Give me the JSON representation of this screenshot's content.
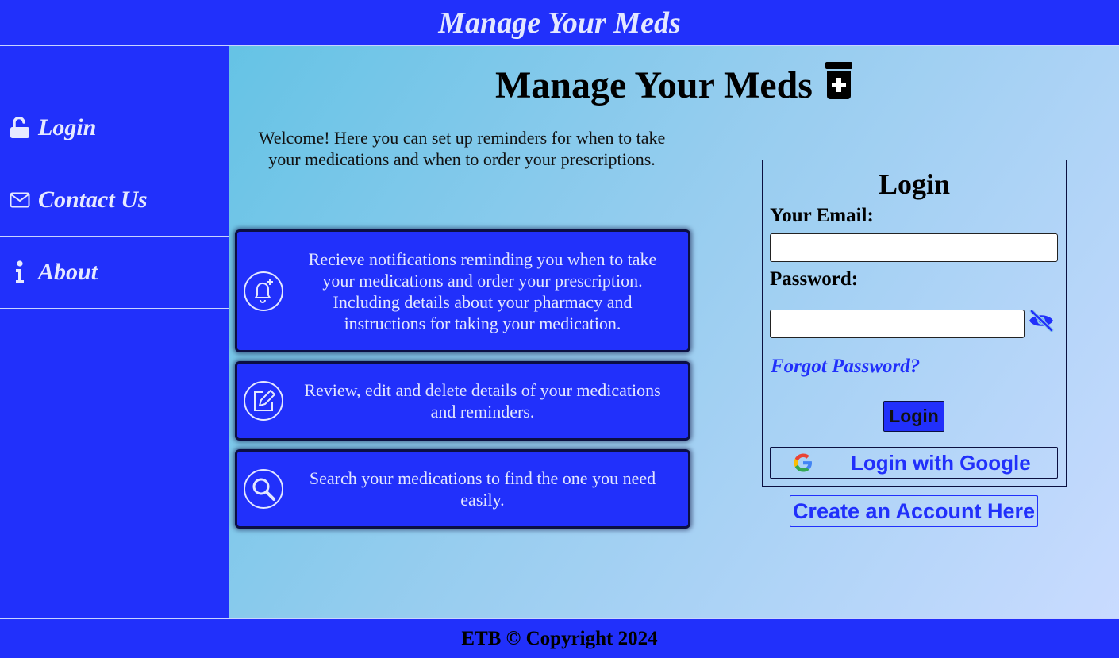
{
  "header": {
    "title": "Manage Your Meds"
  },
  "sidebar": {
    "items": [
      {
        "label": "Login",
        "icon": "unlock-icon"
      },
      {
        "label": "Contact Us",
        "icon": "envelope-icon"
      },
      {
        "label": "About",
        "icon": "info-icon"
      }
    ]
  },
  "main": {
    "title": "Manage Your Meds",
    "title_icon": "prescription-bottle-icon",
    "welcome": "Welcome! Here you can set up reminders for when to take your medications and when to order your prescriptions.",
    "features": [
      {
        "icon": "bell-plus-icon",
        "text": "Recieve notifications reminding you when to take your medications and order your prescription. Including details about your pharmacy and instructions for taking your medication."
      },
      {
        "icon": "edit-icon",
        "text": "Review, edit and delete details of your medications and reminders."
      },
      {
        "icon": "search-icon",
        "text": "Search your medications to find the one you need easily."
      }
    ]
  },
  "login": {
    "heading": "Login",
    "email_label": "Your Email:",
    "email_value": "",
    "password_label": "Password:",
    "password_value": "",
    "forgot": "Forgot Password?",
    "submit": "Login",
    "google": "Login with Google",
    "create_account": "Create an Account Here"
  },
  "footer": {
    "text": "ETB © Copyright 2024"
  },
  "colors": {
    "primary": "#2130fb",
    "text_light": "#e3e7ff"
  }
}
